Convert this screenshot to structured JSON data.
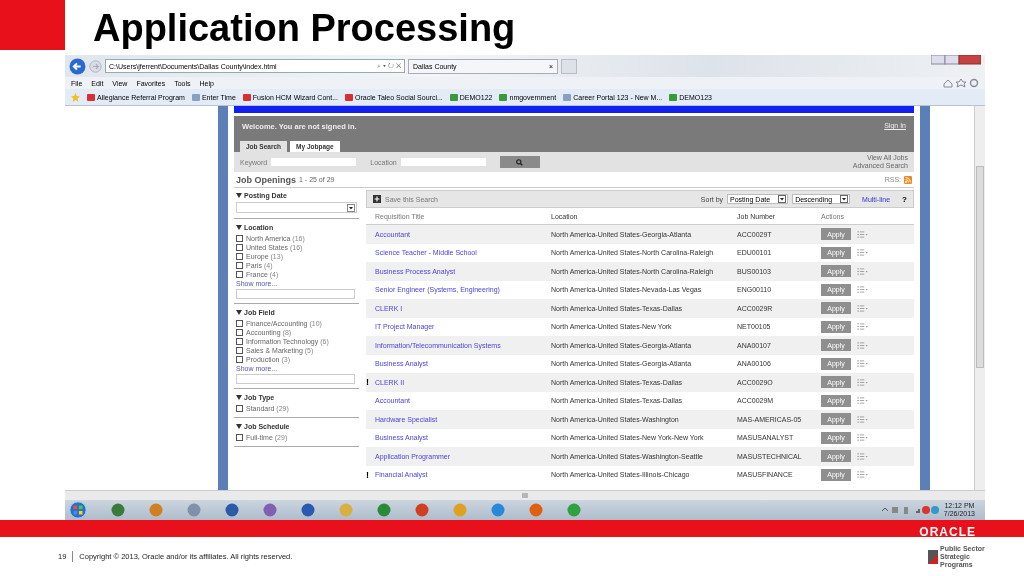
{
  "slide": {
    "title": "Application Processing",
    "page_number": "19",
    "copyright": "Copyright © 2013, Oracle and/or its affiliates. All rights reserved.",
    "brand": "ORACLE",
    "badge_text": "Public Sector Strategic Programs"
  },
  "browser": {
    "address": "C:\\Users\\jferrent\\Documents\\Dallas County\\index.html",
    "search_glyphs": "⌕ ▾ ↻ ✕",
    "tab": "Dallas County",
    "tab_close": "×",
    "menu": [
      "File",
      "Edit",
      "View",
      "Favorites",
      "Tools",
      "Help"
    ],
    "favorites": [
      {
        "label": "Allegiance Referral Program",
        "color": "#d83030"
      },
      {
        "label": "Enter Time",
        "color": "#8aa0c0"
      },
      {
        "label": "Fusion HCM Wizard Cont...",
        "color": "#d83030"
      },
      {
        "label": "Oracle Taleo Social Sourci...",
        "color": "#d83030"
      },
      {
        "label": "DEMO122",
        "color": "#3a9a3a"
      },
      {
        "label": "nmgovernment",
        "color": "#3a9a3a"
      },
      {
        "label": "Career Portal 123 - New M...",
        "color": "#8aa0c0"
      },
      {
        "label": "DEMO123",
        "color": "#3a9a3a"
      }
    ],
    "hscroll_grip": "III"
  },
  "page": {
    "welcome": "Welcome. You are not signed in.",
    "sign_in": "Sign In",
    "tabs": [
      {
        "label": "Job Search",
        "selected": true
      },
      {
        "label": "My Jobpage",
        "selected": false
      }
    ],
    "keyword_label": "Keyword",
    "location_label": "Location",
    "view_all": "View All Jobs",
    "advanced": "Advanced Search",
    "openings_title": "Job Openings",
    "openings_count": "1 - 25 of 29",
    "rss": "RSS:",
    "filters": [
      {
        "title": "Posting Date",
        "kind": "select"
      },
      {
        "title": "Location",
        "kind": "checks",
        "items": [
          {
            "label": "North America",
            "count": "(16)",
            "checked": false
          },
          {
            "label": "United States",
            "count": "(16)",
            "checked": false
          },
          {
            "label": "Europe",
            "count": "(13)",
            "checked": false
          },
          {
            "label": "Paris",
            "count": "(4)",
            "checked": false
          },
          {
            "label": "France",
            "count": "(4)",
            "checked": false
          }
        ],
        "more": "Show more..."
      },
      {
        "title": "Job Field",
        "kind": "checks",
        "items": [
          {
            "label": "Finance/Accounting",
            "count": "(10)",
            "checked": false
          },
          {
            "label": "Accounting",
            "count": "(8)",
            "checked": false
          },
          {
            "label": "Information Technology",
            "count": "(6)",
            "checked": false
          },
          {
            "label": "Sales & Marketing",
            "count": "(5)",
            "checked": false
          },
          {
            "label": "Production",
            "count": "(3)",
            "checked": false
          }
        ],
        "more": "Show more..."
      },
      {
        "title": "Job Type",
        "kind": "checks",
        "items": [
          {
            "label": "Standard",
            "count": "(29)",
            "checked": false
          }
        ]
      },
      {
        "title": "Job Schedule",
        "kind": "checks",
        "items": [
          {
            "label": "Full-time",
            "count": "(29)",
            "checked": false
          }
        ]
      }
    ],
    "save_search": "Save this Search",
    "sort_by": "Sort by",
    "sort_field": "Posting Date",
    "sort_order": "Descending",
    "multi_line": "Multi-line",
    "help": "?",
    "columns": [
      "Requisition Title",
      "Location",
      "Job Number",
      "Actions"
    ],
    "apply": [
      "Apply",
      "Apply",
      "Apply",
      "Apply",
      "Apply",
      "Apply",
      "Apply",
      "Apply",
      "Apply",
      "Apply",
      "Apply",
      "Apply",
      "Apply",
      "Apply"
    ],
    "rows": [
      {
        "title": "Accountant",
        "location": "North America-United States-Georgia-Atlanta",
        "number": "ACC0029T",
        "flagged": false
      },
      {
        "title": "Science Teacher - Middle School",
        "location": "North America-United States-North Carolina-Raleigh",
        "number": "EDU00101",
        "flagged": false
      },
      {
        "title": "Business Process Analyst",
        "location": "North America-United States-North Carolina-Raleigh",
        "number": "BUS00103",
        "flagged": false
      },
      {
        "title": "Senior Engineer (Systems, Engineering)",
        "location": "North America-United States-Nevada-Las Vegas",
        "number": "ENG00110",
        "flagged": false
      },
      {
        "title": "CLERK I",
        "location": "North America-United States-Texas-Dallas",
        "number": "ACC0029R",
        "flagged": false
      },
      {
        "title": "IT Project Manager",
        "location": "North America-United States-New York",
        "number": "NET00105",
        "flagged": false
      },
      {
        "title": "Information/Telecommunication Systems",
        "location": "North America-United States-Georgia-Atlanta",
        "number": "ANA00107",
        "flagged": false
      },
      {
        "title": "Business Analyst",
        "location": "North America-United States-Georgia-Atlanta",
        "number": "ANA00106",
        "flagged": false
      },
      {
        "title": "CLERK II",
        "location": "North America-United States-Texas-Dallas",
        "number": "ACC0029O",
        "flagged": true
      },
      {
        "title": "Accountant",
        "location": "North America-United States-Texas-Dallas",
        "number": "ACC0029M",
        "flagged": false
      },
      {
        "title": "Hardware Specialist",
        "location": "North America-United States-Washington",
        "number": "MAS-AMERICAS-05",
        "flagged": false
      },
      {
        "title": "Business Analyst",
        "location": "North America-United States-New York-New York",
        "number": "MASUSANALYST",
        "flagged": false
      },
      {
        "title": "Application Programmer",
        "location": "North America-United States-Washington-Seattle",
        "number": "MASUSTECHNICAL",
        "flagged": false
      },
      {
        "title": "Financial Analyst",
        "location": "North America-United States-Illinois-Chicago",
        "number": "MASUSFINANCE",
        "flagged": true
      }
    ],
    "flag_mark": "!"
  },
  "taskbar": {
    "apps": [
      {
        "color": "#3a7a3a"
      },
      {
        "color": "#d08020"
      },
      {
        "color": "#8090a8"
      },
      {
        "color": "#2a5aa8"
      },
      {
        "color": "#8060b0"
      },
      {
        "color": "#2a5ab0"
      },
      {
        "color": "#d8b040"
      },
      {
        "color": "#2a8a3a"
      },
      {
        "color": "#d04020"
      },
      {
        "color": "#e0a020"
      },
      {
        "color": "#2a88d8"
      },
      {
        "color": "#e06010"
      },
      {
        "color": "#30a040"
      }
    ],
    "time": "12:12 PM",
    "date": "7/26/2013"
  }
}
